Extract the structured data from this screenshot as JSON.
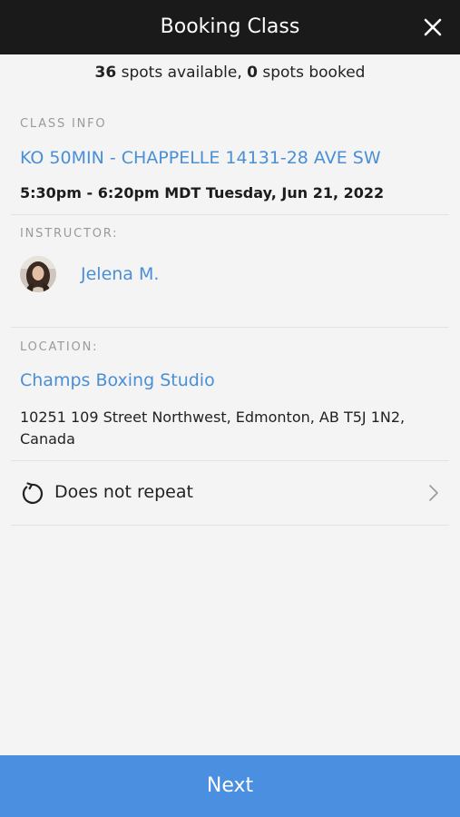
{
  "header": {
    "title": "Booking Class",
    "close_icon": "close-icon"
  },
  "spots": {
    "available_count": "36",
    "available_text": " spots available, ",
    "booked_count": "0",
    "booked_text": " spots booked"
  },
  "class_info": {
    "label": "CLASS INFO",
    "class_name": "KO 50MIN - CHAPPELLE 14131-28 AVE SW",
    "schedule": "5:30pm - 6:20pm MDT Tuesday, Jun 21, 2022"
  },
  "instructor": {
    "label": "INSTRUCTOR:",
    "name": "Jelena M."
  },
  "location": {
    "label": "LOCATION:",
    "name": "Champs Boxing Studio",
    "address": "10251 109 Street Northwest, Edmonton, AB T5J 1N2, Canada"
  },
  "repeat": {
    "label": "Does not repeat",
    "icon": "repeat-icon"
  },
  "footer": {
    "next_label": "Next"
  },
  "colors": {
    "header_bg": "#1a1a1a",
    "link_blue": "#4a8fd6",
    "button_blue": "#4a8fe0",
    "background": "#f4f4f4"
  }
}
